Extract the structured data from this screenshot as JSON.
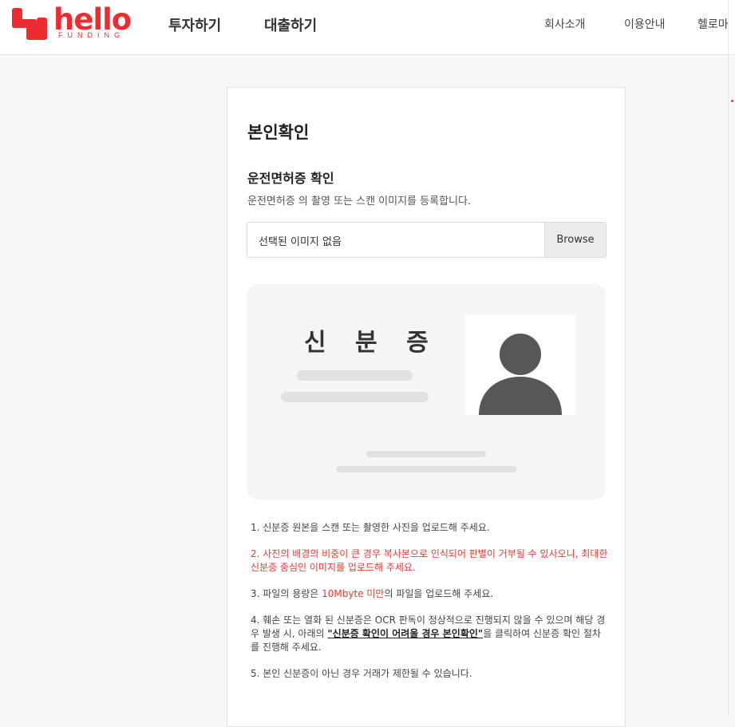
{
  "header": {
    "logo": {
      "word": "hello",
      "sub": "FUNDING",
      "color": "#ee2b2e"
    },
    "nav": [
      "투자하기",
      "대출하기"
    ],
    "util": [
      "회사소개",
      "이용안내",
      "헬로마"
    ]
  },
  "card": {
    "title": "본인확인",
    "section_title": "운전면허증 확인",
    "description": "운전면허증 의 촬영 또는 스캔 이미지를 등록합니다.",
    "file_input": {
      "value": "선택된 이미지 없음",
      "button": "Browse"
    },
    "id_image": {
      "label": "신 분 증",
      "icon": "person-silhouette-icon"
    },
    "notes": {
      "n1": "1. 신분증 원본을 스캔 또는 촬영한 사진을 업로드해 주세요.",
      "n2": "2. 사진의 배경의 비중이 큰 경우 복사본으로 인식되어 판별이 거부될 수 있사오니, 최대한 신분증 중심인 이미지를 업로드해 주세요.",
      "n3_pre": "3. 파일의 용량은 ",
      "n3_highlight": "10Mbyte 미만",
      "n3_post": "의 파일을 업로드해 주세요.",
      "n4_pre": "4. 훼손 또는 열화 된 신분증은 OCR 판독이 정상적으로 진행되지 않을 수 있으며 해당 경우 발생 시, 아래의 ",
      "n4_link": "\"신분증 확인이 어려울 경우 본인확인\"",
      "n4_post": "을 클릭하여 신분증 확인 절차를 진행해 주세요.",
      "n5": "5. 본인 신분증이 아닌 경우 거래가 제한될 수 있습니다."
    }
  },
  "colors": {
    "accent": "#ee2b2e",
    "warning": "#e53935"
  }
}
